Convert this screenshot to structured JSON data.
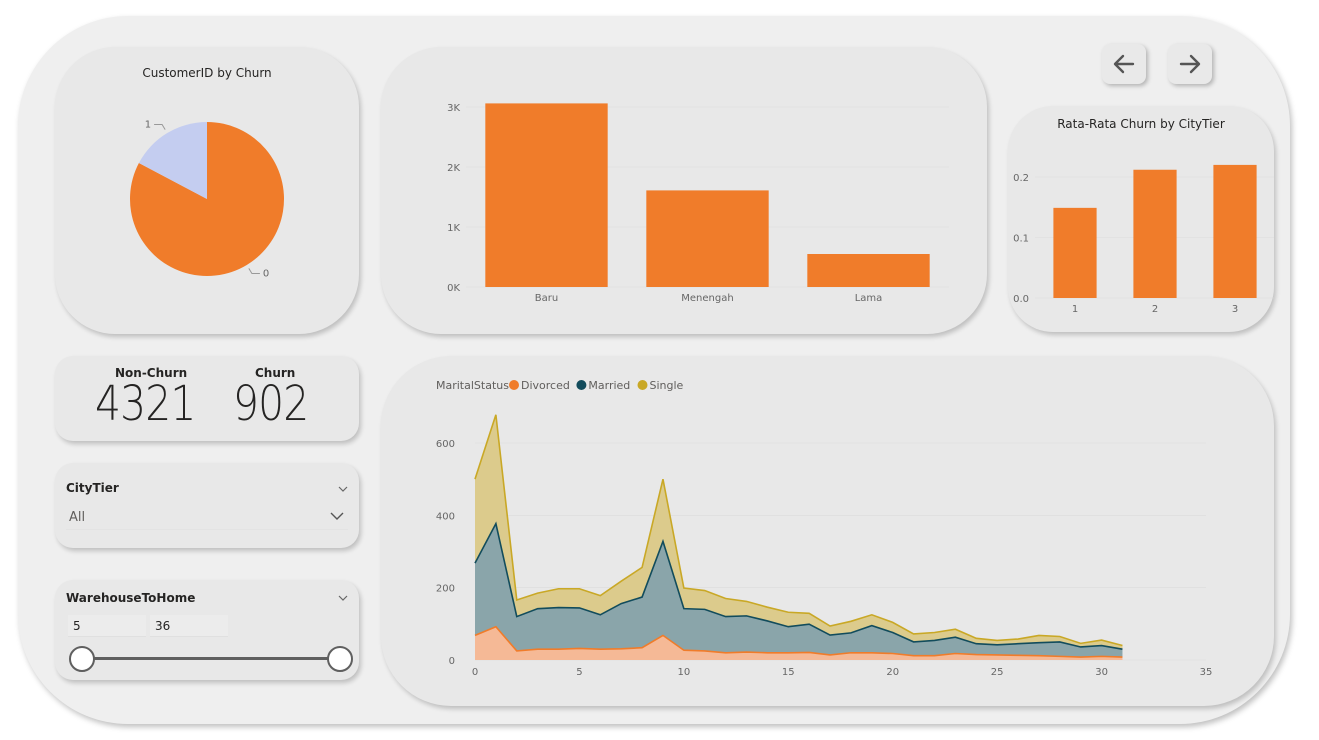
{
  "nav": {
    "back_icon": "arrow-left-icon",
    "forward_icon": "arrow-right-icon"
  },
  "kpi": {
    "non_churn_label": "Non-Churn",
    "non_churn_value": "4321",
    "churn_label": "Churn",
    "churn_value": "902"
  },
  "slicers": {
    "citytier": {
      "title": "CityTier",
      "value": "All"
    },
    "warehouse": {
      "title": "WarehouseToHome",
      "min": "5",
      "max": "36"
    }
  },
  "colors": {
    "orange": "#f07c2a",
    "light_blue": "#c4cdf0",
    "teal": "#124c5c",
    "gold": "#c9a826"
  },
  "chart_data": [
    {
      "type": "pie",
      "title": "CustomerID by Churn",
      "labels": [
        "0",
        "1"
      ],
      "values": [
        4321,
        902
      ],
      "colors": [
        "#f07c2a",
        "#c4cdf0"
      ]
    },
    {
      "type": "bar",
      "title": "",
      "categories": [
        "Baru",
        "Menengah",
        "Lama"
      ],
      "values": [
        3060,
        1610,
        550
      ],
      "ylim": [
        0,
        3200
      ],
      "yticks": [
        "0K",
        "1K",
        "2K",
        "3K"
      ],
      "ytick_values": [
        0,
        1000,
        2000,
        3000
      ]
    },
    {
      "type": "bar",
      "title": "Rata-Rata Churn by CityTier",
      "categories": [
        "1",
        "2",
        "3"
      ],
      "values": [
        0.149,
        0.212,
        0.22
      ],
      "ylim": [
        0,
        0.22
      ],
      "yticks": [
        "0.0",
        "0.1",
        "0.2"
      ],
      "ytick_values": [
        0,
        0.1,
        0.2
      ]
    },
    {
      "type": "area",
      "legend_title": "MaritalStatus",
      "legend_position": "top-left",
      "x": [
        0,
        1,
        2,
        3,
        4,
        5,
        6,
        7,
        8,
        9,
        10,
        11,
        12,
        13,
        14,
        15,
        16,
        17,
        18,
        19,
        20,
        21,
        22,
        23,
        24,
        25,
        26,
        27,
        28,
        29,
        30,
        31
      ],
      "xticks": [
        "0",
        "5",
        "10",
        "15",
        "20",
        "25",
        "30",
        "35"
      ],
      "xtick_values": [
        0,
        5,
        10,
        15,
        20,
        25,
        30,
        35
      ],
      "yticks": [
        "0",
        "200",
        "400",
        "600"
      ],
      "ytick_values": [
        0,
        200,
        400,
        600
      ],
      "xlim": [
        0,
        35
      ],
      "ylim": [
        0,
        680
      ],
      "series": [
        {
          "name": "Divorced",
          "color": "#f07c2a",
          "values": [
            68,
            92,
            25,
            30,
            30,
            32,
            30,
            31,
            34,
            68,
            27,
            25,
            20,
            22,
            20,
            20,
            21,
            14,
            20,
            20,
            18,
            12,
            12,
            18,
            15,
            14,
            13,
            12,
            10,
            8,
            10,
            8
          ]
        },
        {
          "name": "Married",
          "color": "#124c5c",
          "values": [
            200,
            285,
            95,
            112,
            115,
            112,
            95,
            125,
            140,
            260,
            115,
            115,
            100,
            100,
            88,
            72,
            78,
            55,
            55,
            75,
            58,
            38,
            42,
            45,
            30,
            28,
            32,
            36,
            40,
            28,
            30,
            22
          ]
        },
        {
          "name": "Single",
          "color": "#c9a826",
          "values": [
            232,
            301,
            46,
            43,
            52,
            53,
            53,
            62,
            82,
            172,
            57,
            52,
            50,
            40,
            38,
            40,
            30,
            25,
            32,
            30,
            28,
            22,
            22,
            22,
            15,
            12,
            13,
            20,
            15,
            10,
            15,
            10
          ]
        }
      ]
    }
  ]
}
